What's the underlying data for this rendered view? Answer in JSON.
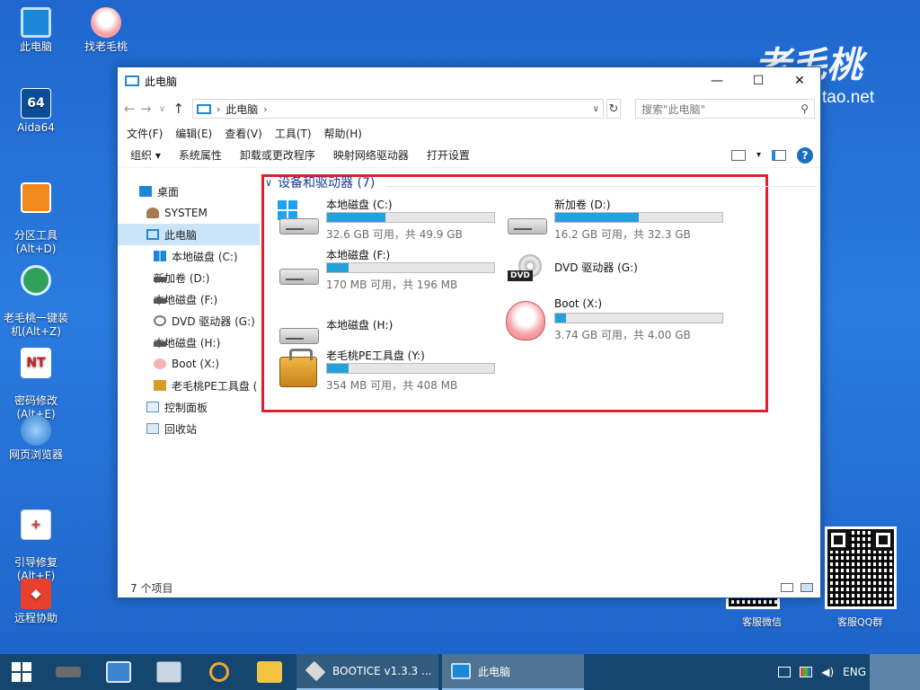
{
  "desktop": {
    "icons": [
      {
        "label": "此电脑"
      },
      {
        "label": "找老毛桃"
      },
      {
        "label": "Aida64"
      },
      {
        "label": "分区工具\n(Alt+D)"
      },
      {
        "label": "老毛桃一键装\n机(Alt+Z)"
      },
      {
        "label": "密码修改\n(Alt+E)"
      },
      {
        "label": "网页浏览器"
      },
      {
        "label": "引导修复\n(Alt+F)"
      },
      {
        "label": "远程协助"
      }
    ],
    "aida_glyph": "64",
    "watermark_logo": "老毛桃",
    "watermark_url": "tao.net",
    "qr_wechat_label": "客服微信",
    "qr_qq_label": "客服QQ群"
  },
  "window": {
    "title": "此电脑",
    "controls": {
      "minimize": "—",
      "maximize": "☐",
      "close": "✕"
    },
    "address": {
      "location": "此电脑",
      "separator": "›",
      "search_placeholder": "搜索\"此电脑\""
    },
    "menu": [
      "文件(F)",
      "编辑(E)",
      "查看(V)",
      "工具(T)",
      "帮助(H)"
    ],
    "toolbar": {
      "organize": "组织 ▾",
      "items": [
        "系统属性",
        "卸载或更改程序",
        "映射网络驱动器",
        "打开设置"
      ],
      "help": "?"
    },
    "nav": [
      {
        "label": "桌面",
        "icon": "desktop-icon"
      },
      {
        "label": "SYSTEM",
        "icon": "user-folder-icon"
      },
      {
        "label": "此电脑",
        "icon": "computer-icon"
      },
      {
        "label": "本地磁盘 (C:)",
        "icon": "windows-drive-icon"
      },
      {
        "label": "新加卷 (D:)",
        "icon": "drive-icon"
      },
      {
        "label": "本地磁盘 (F:)",
        "icon": "drive-icon"
      },
      {
        "label": "DVD 驱动器 (G:)",
        "icon": "dvd-icon"
      },
      {
        "label": "本地磁盘 (H:)",
        "icon": "drive-icon"
      },
      {
        "label": "Boot (X:)",
        "icon": "boot-drive-icon"
      },
      {
        "label": "老毛桃PE工具盘 (",
        "icon": "toolbox-drive-icon"
      },
      {
        "label": "控制面板",
        "icon": "control-panel-icon"
      },
      {
        "label": "回收站",
        "icon": "recycle-bin-icon"
      }
    ],
    "group": {
      "title": "设备和驱动器 (7)",
      "chevron": "∨"
    },
    "drives": [
      {
        "name": "本地磁盘 (C:)",
        "info": "32.6 GB 可用，共 49.9 GB",
        "used_fraction": 0.35,
        "icon": "windows-hdd"
      },
      {
        "name": "新加卷 (D:)",
        "info": "16.2 GB 可用，共 32.3 GB",
        "used_fraction": 0.5,
        "icon": "hdd"
      },
      {
        "name": "本地磁盘 (F:)",
        "info": "170 MB 可用，共 196 MB",
        "used_fraction": 0.13,
        "icon": "hdd"
      },
      {
        "name": "DVD 驱动器 (G:)",
        "info": "",
        "used_fraction": null,
        "icon": "dvd"
      },
      {
        "name": "本地磁盘 (H:)",
        "info": "",
        "used_fraction": null,
        "icon": "hdd"
      },
      {
        "name": "Boot (X:)",
        "info": "3.74 GB 可用，共 4.00 GB",
        "used_fraction": 0.065,
        "icon": "peach"
      },
      {
        "name": "老毛桃PE工具盘 (Y:)",
        "info": "354 MB 可用，共 408 MB",
        "used_fraction": 0.13,
        "icon": "toolbox"
      }
    ],
    "status": {
      "count": "7 个项目"
    }
  },
  "taskbar": {
    "apps": [
      {
        "label": "BOOTICE v1.3.3 ..."
      },
      {
        "label": "此电脑"
      }
    ],
    "language": "ENG"
  },
  "colors": {
    "accent": "#26a0da",
    "highlight_box": "#e0212c",
    "taskbar": "#15466f"
  }
}
